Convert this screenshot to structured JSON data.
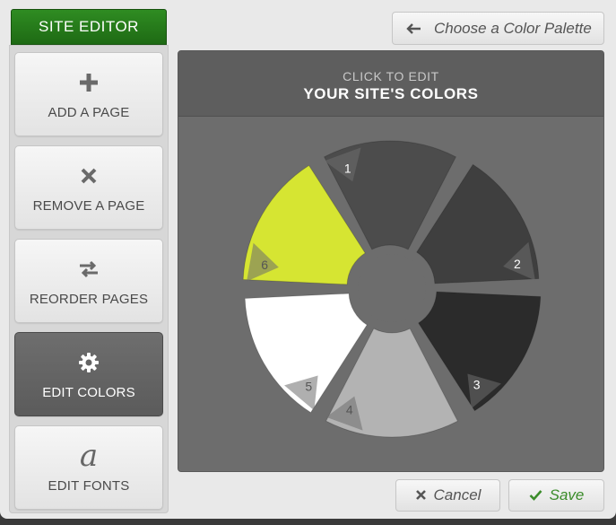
{
  "sidebar": {
    "title": "SITE EDITOR",
    "items": [
      {
        "label": "ADD A PAGE",
        "icon": "plus-icon",
        "active": false
      },
      {
        "label": "REMOVE A PAGE",
        "icon": "x-icon",
        "active": false
      },
      {
        "label": "REORDER PAGES",
        "icon": "swap-arrows-icon",
        "active": false
      },
      {
        "label": "EDIT COLORS",
        "icon": "gear-icon",
        "active": true
      },
      {
        "label": "EDIT FONTS",
        "icon": "font-a-icon",
        "icon_glyph": "a",
        "active": false
      }
    ]
  },
  "toolbar": {
    "palette_label": "Choose a Color Palette"
  },
  "main": {
    "subtitle": "CLICK TO EDIT",
    "title": "YOUR SITE'S COLORS",
    "swatches": [
      {
        "number": "1",
        "color": "#4c4c4c"
      },
      {
        "number": "2",
        "color": "#3f3f3f"
      },
      {
        "number": "3",
        "color": "#2b2b2b"
      },
      {
        "number": "4",
        "color": "#b3b3b3"
      },
      {
        "number": "5",
        "color": "#ffffff"
      },
      {
        "number": "6",
        "color": "#d6e532"
      }
    ]
  },
  "actions": {
    "cancel_label": "Cancel",
    "save_label": "Save"
  },
  "colors": {
    "accent_green": "#2a7c1c",
    "save_text": "#3b8c2a"
  }
}
